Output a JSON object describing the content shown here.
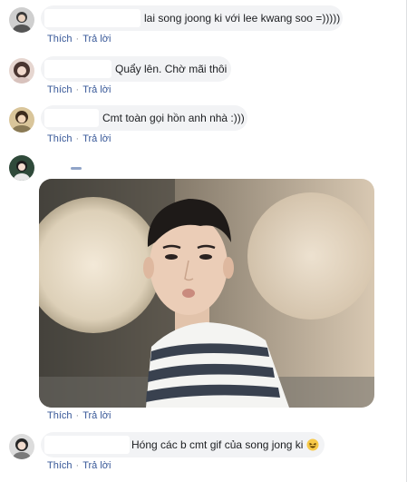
{
  "comments": [
    {
      "text": "lai song joong ki với lee kwang soo =)))))",
      "actions": {
        "like": "Thích",
        "reply": "Trả lời"
      }
    },
    {
      "text": "Quẩy lên. Chờ mãi thôi",
      "actions": {
        "like": "Thích",
        "reply": "Trả lời"
      }
    },
    {
      "text": "Cmt toàn gọi hồn anh nhà :)))",
      "actions": {
        "like": "Thích",
        "reply": "Trả lời"
      }
    },
    {
      "actions": {
        "like": "Thích",
        "reply": "Trả lời"
      }
    },
    {
      "text": "Hóng các b cmt gif của song jong ki",
      "emoji": "laughing-emoji",
      "actions": {
        "like": "Thích",
        "reply": "Trả lời"
      }
    }
  ],
  "separator": "·",
  "colors": {
    "link": "#385898",
    "bubble": "#f2f3f5",
    "text": "#1c1e21"
  }
}
